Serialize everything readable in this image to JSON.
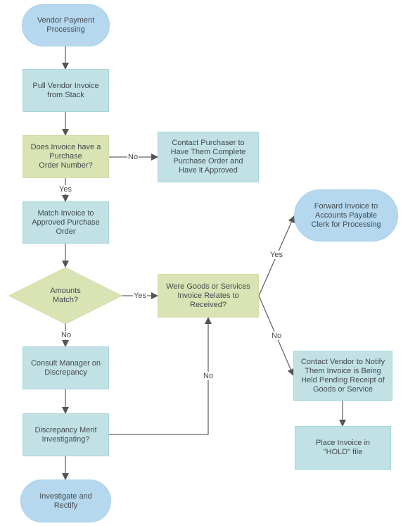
{
  "diagram": {
    "title": "Vendor Payment Processing",
    "colors": {
      "process": "#c1e1e4",
      "decision": "#d9e3b3",
      "terminal": "#b5d8ef",
      "edge": "#606060",
      "text": "#444a4f"
    },
    "nodes": {
      "start": {
        "label": "Vendor Payment\nProcessing",
        "type": "terminal"
      },
      "pull_invoice": {
        "label": "Pull Vendor Invoice\nfrom Stack",
        "type": "process"
      },
      "has_po": {
        "label": "Does Invoice have a\nPurchase\nOrder Number?",
        "type": "decision"
      },
      "contact_purchaser": {
        "label": "Contact Purchaser to\nHave Them Complete\nPurchase Order and\nHave it Approved",
        "type": "process"
      },
      "match_invoice": {
        "label": "Match Invoice to\nApproved Purchase\nOrder",
        "type": "process"
      },
      "amounts_match": {
        "label": "Amounts\nMatch?",
        "type": "decision"
      },
      "goods_received": {
        "label": "Were Goods or Services\nInvoice Relates to\nReceived?",
        "type": "decision"
      },
      "forward_invoice": {
        "label": "Forward Invoice to\nAccounts Payable\nClerk for Processing",
        "type": "terminal"
      },
      "consult_manager": {
        "label": "Consult Manager on\nDiscrepancy",
        "type": "process"
      },
      "contact_vendor": {
        "label": "Contact Vendor to Notify\nThem Invoice is Being\nHeld Pending Receipt of\nGoods or Service",
        "type": "process"
      },
      "discrepancy_merit": {
        "label": "Discrepancy Merit\nInvestigating?",
        "type": "process"
      },
      "place_hold": {
        "label": "Place Invoice in\n\"HOLD\" file",
        "type": "process"
      },
      "investigate": {
        "label": "Investigate and\nRectify",
        "type": "terminal"
      }
    },
    "edges": [
      {
        "from": "start",
        "to": "pull_invoice",
        "label": ""
      },
      {
        "from": "pull_invoice",
        "to": "has_po",
        "label": ""
      },
      {
        "from": "has_po",
        "to": "contact_purchaser",
        "label": "No"
      },
      {
        "from": "has_po",
        "to": "match_invoice",
        "label": "Yes"
      },
      {
        "from": "match_invoice",
        "to": "amounts_match",
        "label": ""
      },
      {
        "from": "amounts_match",
        "to": "goods_received",
        "label": "Yes"
      },
      {
        "from": "amounts_match",
        "to": "consult_manager",
        "label": "No"
      },
      {
        "from": "goods_received",
        "to": "forward_invoice",
        "label": "Yes"
      },
      {
        "from": "goods_received",
        "to": "contact_vendor",
        "label": "No"
      },
      {
        "from": "consult_manager",
        "to": "discrepancy_merit",
        "label": ""
      },
      {
        "from": "discrepancy_merit",
        "to": "goods_received",
        "label": "No"
      },
      {
        "from": "discrepancy_merit",
        "to": "investigate",
        "label": ""
      },
      {
        "from": "contact_vendor",
        "to": "place_hold",
        "label": ""
      }
    ]
  }
}
